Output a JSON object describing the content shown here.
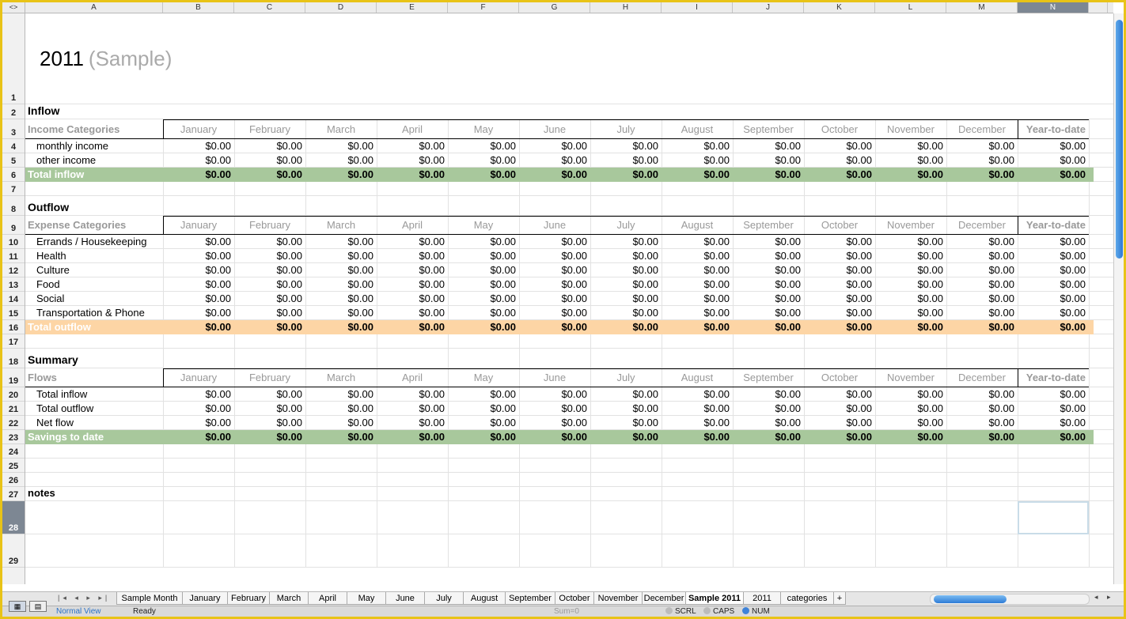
{
  "column_letters": [
    "A",
    "B",
    "C",
    "D",
    "E",
    "F",
    "G",
    "H",
    "I",
    "J",
    "K",
    "L",
    "M",
    "N"
  ],
  "selected_column": "N",
  "selected_row": "28",
  "title": {
    "year": "2011",
    "sub": "(Sample)"
  },
  "months": [
    "January",
    "February",
    "March",
    "April",
    "May",
    "June",
    "July",
    "August",
    "September",
    "October",
    "November",
    "December"
  ],
  "ytd_label": "Year-to-date",
  "inflow": {
    "heading": "Inflow",
    "category_label": "Income Categories",
    "rows": [
      {
        "label": "monthly income"
      },
      {
        "label": "other income"
      }
    ],
    "total_label": "Total inflow"
  },
  "outflow": {
    "heading": "Outflow",
    "category_label": "Expense Categories",
    "rows": [
      {
        "label": "Errands / Housekeeping"
      },
      {
        "label": "Health"
      },
      {
        "label": "Culture"
      },
      {
        "label": "Food"
      },
      {
        "label": "Social"
      },
      {
        "label": "Transportation & Phone"
      }
    ],
    "total_label": "Total outflow"
  },
  "summary": {
    "heading": "Summary",
    "category_label": "Flows",
    "rows": [
      {
        "label": "Total inflow"
      },
      {
        "label": "Total outflow"
      },
      {
        "label": "Net flow"
      }
    ],
    "total_label": "Savings to date"
  },
  "cell_value": "$0.00",
  "notes_label": "notes",
  "colors": {
    "inflow_band": "#a8c89c",
    "outflow_band": "#fdd5a5",
    "summary_band": "#a8c89c"
  },
  "sheet_tabs": [
    "Sample Month",
    "January",
    "February",
    "March",
    "April",
    "May",
    "June",
    "July",
    "August",
    "September",
    "October",
    "November",
    "December",
    "Sample 2011",
    "2011",
    "categories"
  ],
  "active_tab": "Sample 2011",
  "add_tab": "+",
  "status": {
    "view": "Normal View",
    "ready": "Ready",
    "sum": "Sum=0",
    "scrl": "SCRL",
    "caps": "CAPS",
    "num": "NUM"
  }
}
